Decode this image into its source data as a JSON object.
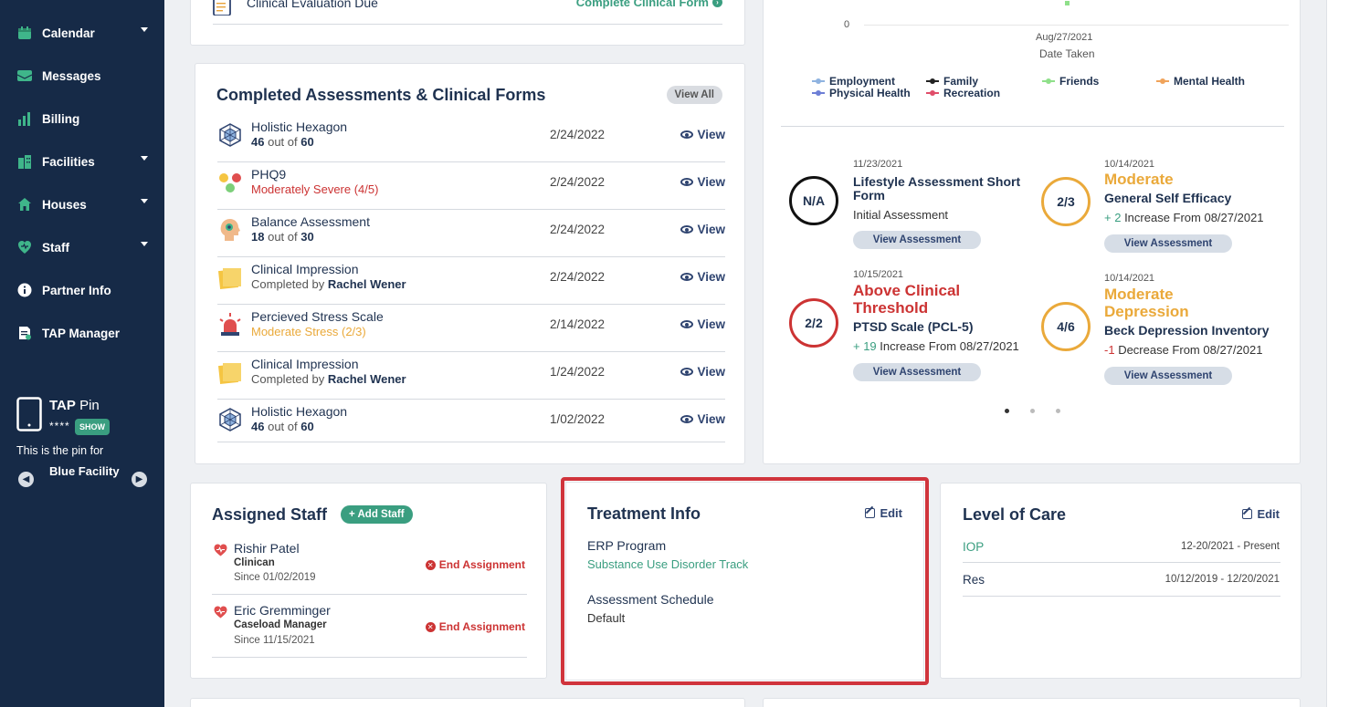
{
  "sidebar": {
    "items": [
      {
        "label": "Calendar",
        "icon": "calendar-icon"
      },
      {
        "label": "Messages",
        "icon": "messages-icon"
      },
      {
        "label": "Billing",
        "icon": "bar-chart-icon"
      },
      {
        "label": "Facilities",
        "icon": "building-icon"
      },
      {
        "label": "Houses",
        "icon": "house-icon"
      },
      {
        "label": "Staff",
        "icon": "heart-shield-icon"
      },
      {
        "label": "Partner Info",
        "icon": "info-icon"
      },
      {
        "label": "TAP Manager",
        "icon": "document-icon"
      }
    ],
    "tap": {
      "title_bold": "TAP",
      "title_rest": "Pin",
      "pin_mask": "****",
      "show_label": "SHOW",
      "desc": "This is the pin for",
      "facility": "Blue Facility"
    }
  },
  "clinical_eval": {
    "title": "Clinical Evaluation Due",
    "action": "Complete Clinical Form"
  },
  "completed": {
    "title": "Completed Assessments & Clinical Forms",
    "view_all": "View All",
    "view_label": "View",
    "rows": [
      {
        "name": "Holistic Hexagon",
        "score": "46",
        "sep": "out of",
        "max": "60",
        "date": "2/24/2022"
      },
      {
        "name": "PHQ9",
        "status": "Moderately Severe (4/5)",
        "date": "2/24/2022"
      },
      {
        "name": "Balance Assessment",
        "score": "18",
        "sep": "out of",
        "max": "30",
        "date": "2/24/2022"
      },
      {
        "name": "Clinical Impression",
        "by": "Completed by",
        "author": "Rachel Wener",
        "date": "2/24/2022"
      },
      {
        "name": "Percieved Stress Scale",
        "status": "Moderate Stress (2/3)",
        "date": "2/14/2022"
      },
      {
        "name": "Clinical Impression",
        "by": "Completed by",
        "author": "Rachel Wener",
        "date": "1/24/2022"
      },
      {
        "name": "Holistic Hexagon",
        "score": "46",
        "sep": "out of",
        "max": "60",
        "date": "1/02/2022"
      }
    ]
  },
  "chart": {
    "y_tick": "0",
    "x_tick": "Aug/27/2021",
    "x_label": "Date Taken",
    "legend": [
      {
        "name": "Employment",
        "color": "#8fb3e0"
      },
      {
        "name": "Physical Health",
        "color": "#6d7fd6"
      },
      {
        "name": "Family",
        "color": "#222222"
      },
      {
        "name": "Recreation",
        "color": "#e04e6a"
      },
      {
        "name": "Friends",
        "color": "#8fe08a"
      },
      {
        "name": "Mental Health",
        "color": "#f0a35a"
      }
    ]
  },
  "scores": {
    "button": "View Assessment",
    "items": [
      {
        "circle": "N/A",
        "date": "11/23/2021",
        "name": "Lifestyle Assessment Short Form",
        "sub": "Initial Assessment"
      },
      {
        "circle": "2/3",
        "date": "10/14/2021",
        "level": "Moderate",
        "name": "General Self Efficacy",
        "delta": "+ 2",
        "sub": "Increase From 08/27/2021"
      },
      {
        "circle": "2/2",
        "date": "10/15/2021",
        "level": "Above Clinical Threshold",
        "name": "PTSD Scale (PCL-5)",
        "delta": "+ 19",
        "sub": "Increase From 08/27/2021"
      },
      {
        "circle": "4/6",
        "date": "10/14/2021",
        "level": "Moderate Depression",
        "name": "Beck Depression Inventory",
        "delta": "-1",
        "sub": "Decrease From 08/27/2021"
      }
    ]
  },
  "assigned_staff": {
    "title": "Assigned Staff",
    "add_label": "+ Add Staff",
    "end_label": "End Assignment",
    "staff": [
      {
        "name": "Rishir Patel",
        "role": "Clinican",
        "since": "Since 01/02/2019"
      },
      {
        "name": "Eric Gremminger",
        "role": "Caseload Manager",
        "since": "Since 11/15/2021"
      }
    ]
  },
  "treatment": {
    "title": "Treatment Info",
    "edit": "Edit",
    "program_label": "ERP Program",
    "program_value": "Substance Use Disorder Track",
    "schedule_label": "Assessment Schedule",
    "schedule_value": "Default"
  },
  "level_of_care": {
    "title": "Level of Care",
    "edit": "Edit",
    "rows": [
      {
        "name": "IOP",
        "range": "12-20/2021 - Present"
      },
      {
        "name": "Res",
        "range": "10/12/2019 - 12/20/2021"
      }
    ]
  },
  "colors": {
    "sidebar": "#162a47",
    "accent_green": "#3a9e80",
    "danger": "#cc3333",
    "warning": "#eaa93a"
  }
}
